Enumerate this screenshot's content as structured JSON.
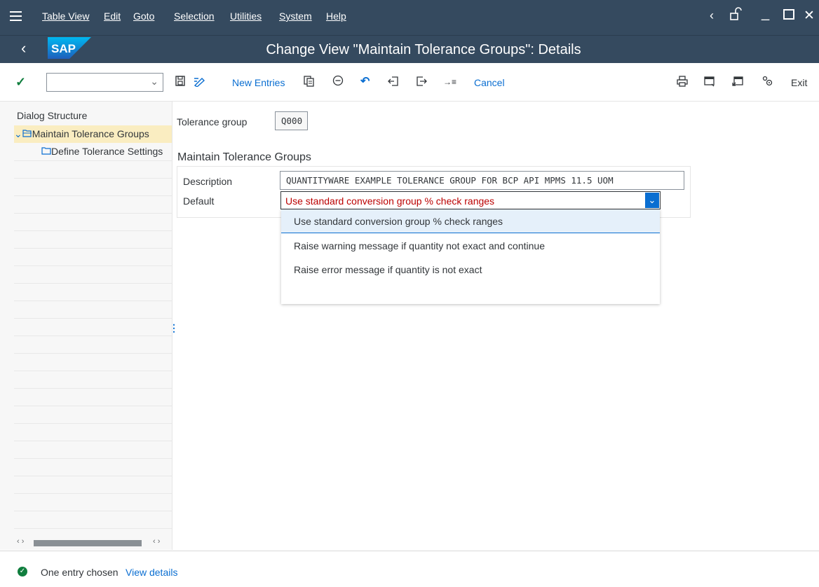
{
  "menu": {
    "items": [
      "Table View",
      "Edit",
      "Goto",
      "Selection",
      "Utilities",
      "System",
      "Help"
    ]
  },
  "title": "Change View \"Maintain Tolerance Groups\": Details",
  "toolbar": {
    "command_value": "",
    "new_entries": "New Entries",
    "cancel": "Cancel",
    "exit": "Exit"
  },
  "dialog": {
    "header": "Dialog Structure",
    "items": [
      "Maintain Tolerance Groups",
      "Define Tolerance Settings"
    ]
  },
  "form": {
    "tolerance_group_label": "Tolerance group",
    "tolerance_group_value": "Q000",
    "group_title": "Maintain Tolerance Groups",
    "description_label": "Description",
    "description_value": "QUANTITYWARE EXAMPLE TOLERANCE GROUP FOR BCP API MPMS 11.5 UOM",
    "default_label": "Default",
    "default_value": "Use standard conversion group % check ranges",
    "options": [
      "Use standard conversion group % check ranges",
      "Raise warning message if quantity not exact and continue",
      "Raise error message if quantity is not exact"
    ]
  },
  "status": {
    "message": "One entry chosen",
    "link": "View details"
  },
  "colors": {
    "shell": "#354a5f",
    "accent": "#0a6ed1",
    "success": "#107e3e",
    "error_text": "#bb0000",
    "tree_selected": "#faedc1"
  }
}
